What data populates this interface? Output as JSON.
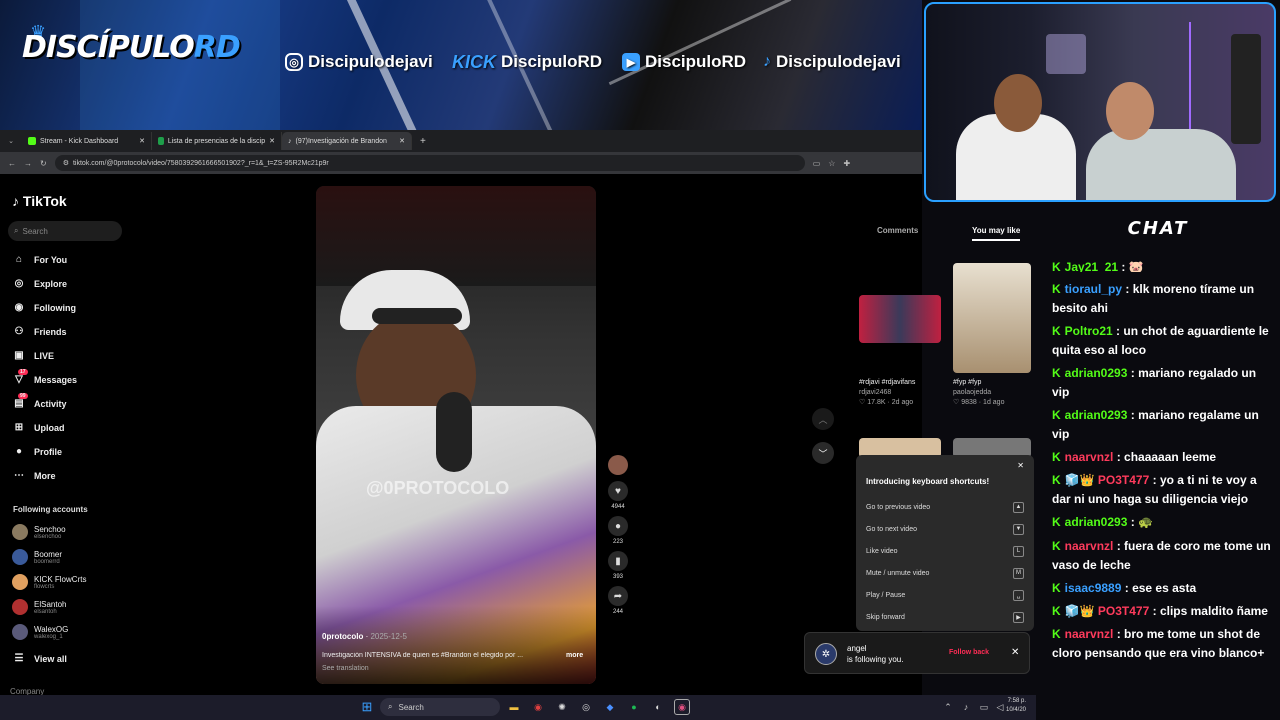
{
  "banner": {
    "logo_main": "DISCÍPULO",
    "logo_accent": "RD",
    "socials": [
      {
        "icon": "instagram-icon",
        "handle": "Discipulodejavi"
      },
      {
        "icon": "kick-icon",
        "label": "KICK",
        "handle": "DiscipuloRD"
      },
      {
        "icon": "youtube-icon",
        "handle": "DiscipuloRD"
      },
      {
        "icon": "tiktok-icon",
        "handle": "Discipulodejavi"
      }
    ]
  },
  "browser": {
    "tabs": [
      {
        "title": "Stream - Kick Dashboard"
      },
      {
        "title": "Lista de presencias de la discip"
      },
      {
        "title": "(97)Investigación de Brandon"
      }
    ],
    "url": "tiktok.com/@0protocolo/video/7580392961666501902?_r=1&_t=ZS-95R2Mc21p9r"
  },
  "tiktok": {
    "logo": "TikTok",
    "search_placeholder": "Search",
    "nav": [
      {
        "label": "For You",
        "icon": "home-icon"
      },
      {
        "label": "Explore",
        "icon": "compass-icon"
      },
      {
        "label": "Following",
        "icon": "following-icon"
      },
      {
        "label": "Friends",
        "icon": "friends-icon"
      },
      {
        "label": "LIVE",
        "icon": "live-icon"
      },
      {
        "label": "Messages",
        "icon": "messages-icon",
        "badge": "17"
      },
      {
        "label": "Activity",
        "icon": "activity-icon",
        "badge": "99"
      },
      {
        "label": "Upload",
        "icon": "upload-icon"
      },
      {
        "label": "Profile",
        "icon": "profile-icon"
      },
      {
        "label": "More",
        "icon": "more-icon"
      }
    ],
    "following_title": "Following accounts",
    "following": [
      {
        "name": "Senchoo",
        "handle": "elsenchoo"
      },
      {
        "name": "Boomer",
        "handle": "boomerrd"
      },
      {
        "name": "KICK FlowCrts",
        "handle": "flowcrts"
      },
      {
        "name": "ElSantoh",
        "handle": "elsantoh"
      },
      {
        "name": "WalexOG",
        "handle": "walexog_1"
      }
    ],
    "view_all": "View all",
    "company": "Company",
    "video": {
      "watermark": "@0PROTOCOLO",
      "author": "0protocolo",
      "date": "2025-12-5",
      "caption": "Investigación INTENSIVA de quien es #Brandon el elegido por ...",
      "more": "more",
      "see_translation": "See translation",
      "likes": "4944",
      "comments": "223",
      "saves": "393",
      "shares": "244"
    },
    "right_tabs": {
      "comments": "Comments",
      "you_may_like": "You may like"
    },
    "suggestions": [
      {
        "title": "#rdjavi #rdjavifans",
        "author": "rdjavi2468",
        "likes": "17.8K",
        "age": "2d ago"
      },
      {
        "title": "#fyp #fyp",
        "author": "paolaojedda",
        "likes": "9838",
        "age": "1d ago"
      }
    ],
    "shortcuts": {
      "title": "Introducing keyboard shortcuts!",
      "items": [
        {
          "label": "Go to previous video",
          "key": "▲"
        },
        {
          "label": "Go to next video",
          "key": "▼"
        },
        {
          "label": "Like video",
          "key": "L"
        },
        {
          "label": "Mute / unmute video",
          "key": "M"
        },
        {
          "label": "Play / Pause",
          "key": "␣"
        },
        {
          "label": "Skip forward",
          "key": "▶"
        }
      ]
    },
    "notification": {
      "name": "angel",
      "text": "is following you.",
      "action": "Follow back"
    }
  },
  "taskbar": {
    "search": "Search",
    "time": "7:58 p.",
    "date": "10/4/20"
  },
  "chat": {
    "title": "CHAT",
    "messages": [
      {
        "user": "Jay21_21",
        "color": "#53fc18",
        "text": " 🐷"
      },
      {
        "user": "tioraul_py",
        "color": "#3aa0ff",
        "text": "klk moreno tírame un besito ahi"
      },
      {
        "user": "Poltro21",
        "color": "#53fc18",
        "text": "un chot de aguardiente le quita eso al loco"
      },
      {
        "user": "adrian0293",
        "color": "#53fc18",
        "text": "mariano regalado un vip"
      },
      {
        "user": "adrian0293",
        "color": "#53fc18",
        "text": "mariano regalame un vip"
      },
      {
        "user": "naarvnzl",
        "color": "#ff3b5c",
        "text": "chaaaaan leeme"
      },
      {
        "user": "PO3T477",
        "color": "#ff3b5c",
        "badges": "🧊👑",
        "text": "yo a ti ni te voy a dar ni uno haga su diligencia viejo"
      },
      {
        "user": "adrian0293",
        "color": "#53fc18",
        "text": "🐢"
      },
      {
        "user": "naarvnzl",
        "color": "#ff3b5c",
        "text": "fuera de coro me tome un vaso de leche"
      },
      {
        "user": "isaac9889",
        "color": "#3aa0ff",
        "text": "ese es asta"
      },
      {
        "user": "PO3T477",
        "color": "#ff3b5c",
        "badges": "🧊👑",
        "text": "clips maldito ñame"
      },
      {
        "user": "naarvnzl",
        "color": "#ff3b5c",
        "text": "bro me tome un shot de cloro pensando que era vino blanco+"
      }
    ]
  }
}
